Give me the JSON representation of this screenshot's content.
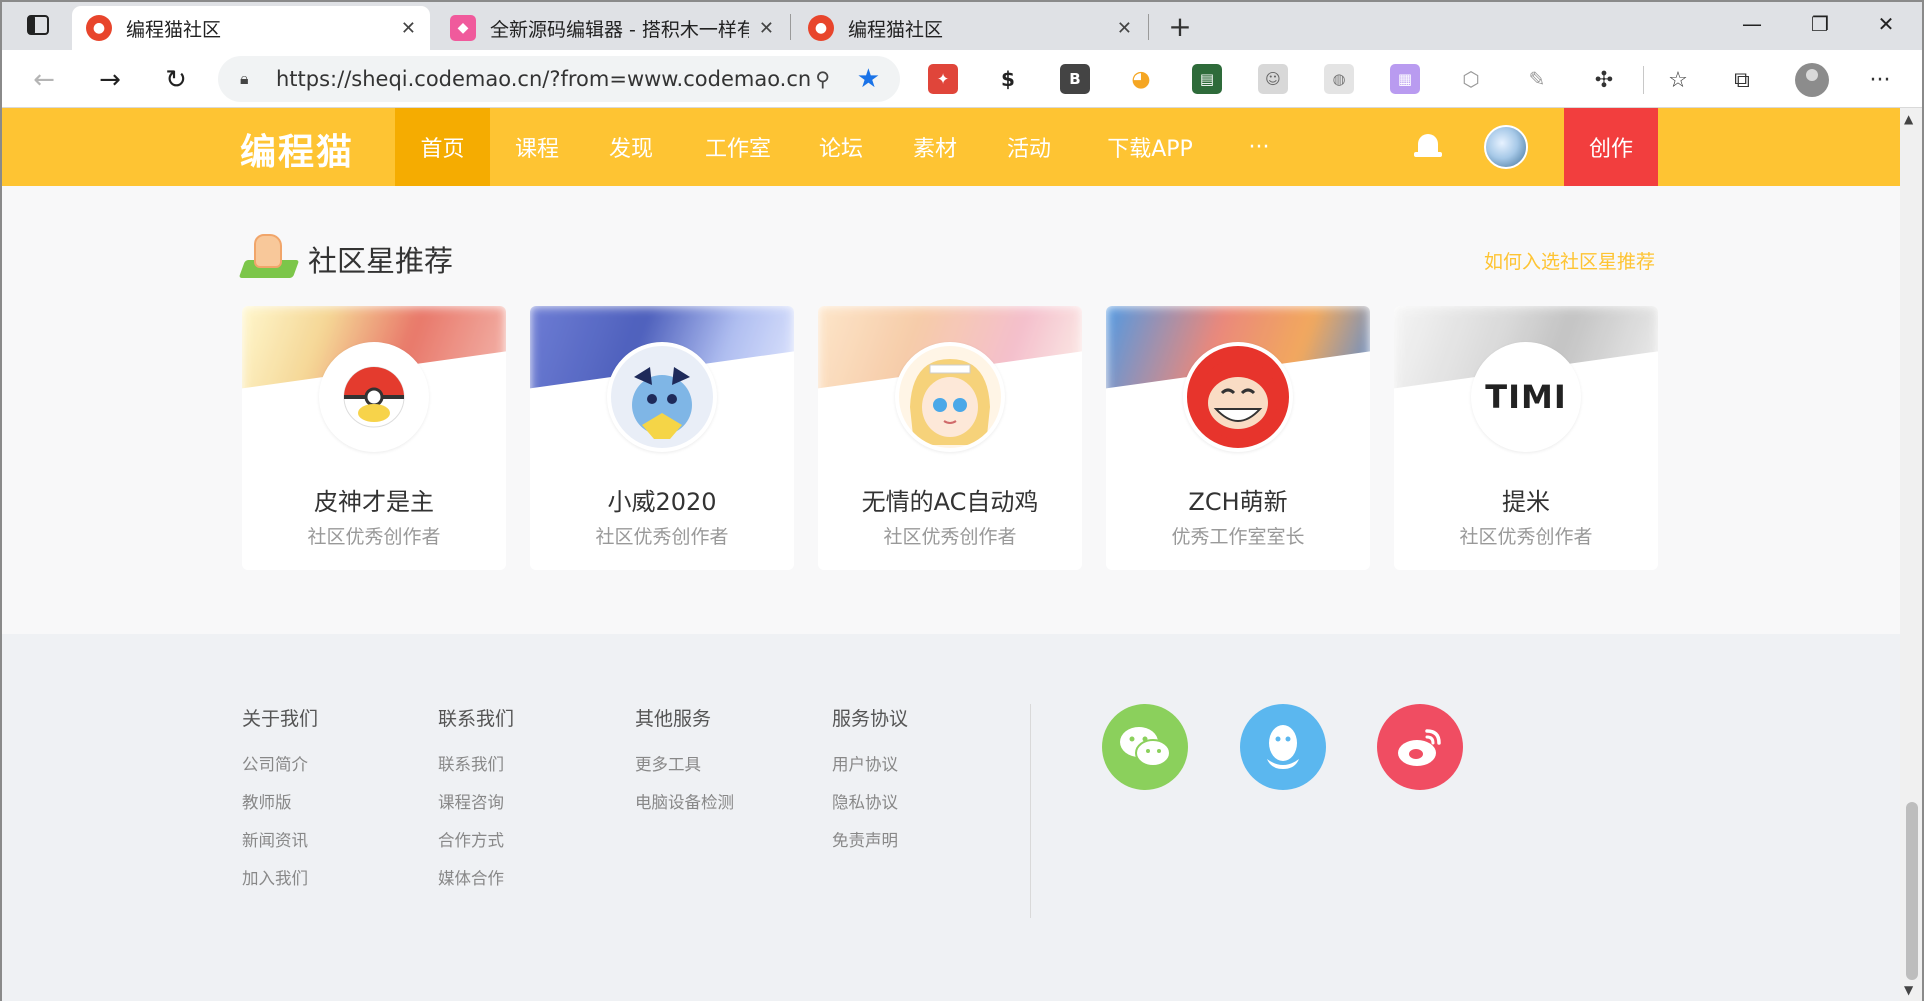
{
  "browser": {
    "tabs": [
      {
        "title": "编程猫社区",
        "active": true
      },
      {
        "title": "全新源码编辑器 - 搭积木一样有趣",
        "active": false
      },
      {
        "title": "编程猫社区",
        "active": false
      }
    ],
    "url": "https://sheqi.codemao.cn/?from=www.codemao.cn",
    "extensions": [
      "ext-1",
      "ext-s",
      "ext-b",
      "ext-palette",
      "ext-4",
      "ext-5",
      "ext-6",
      "ext-7",
      "ext-office",
      "ext-pen"
    ]
  },
  "nav": {
    "logo": "编程猫",
    "items": [
      "首页",
      "课程",
      "发现",
      "工作室",
      "论坛",
      "素材",
      "活动",
      "下载APP",
      "···"
    ],
    "create": "创作"
  },
  "recommend": {
    "title": "社区星推荐",
    "link": "如何入选社区星推荐",
    "cards": [
      {
        "name": "皮神才是主",
        "role": "社区优秀创作者",
        "avatar_text": ""
      },
      {
        "name": "小威2020",
        "role": "社区优秀创作者",
        "avatar_text": ""
      },
      {
        "name": "无情的AC自动鸡",
        "role": "社区优秀创作者",
        "avatar_text": ""
      },
      {
        "name": "ZCH萌新",
        "role": "优秀工作室室长",
        "avatar_text": ""
      },
      {
        "name": "提米",
        "role": "社区优秀创作者",
        "avatar_text": "TIMI"
      }
    ]
  },
  "footer": {
    "columns": [
      {
        "heading": "关于我们",
        "links": [
          "公司简介",
          "教师版",
          "新闻资讯",
          "加入我们"
        ]
      },
      {
        "heading": "联系我们",
        "links": [
          "联系我们",
          "课程咨询",
          "合作方式",
          "媒体合作"
        ]
      },
      {
        "heading": "其他服务",
        "links": [
          "更多工具",
          "电脑设备检测"
        ]
      },
      {
        "heading": "服务协议",
        "links": [
          "用户协议",
          "隐私协议",
          "免责声明"
        ]
      }
    ],
    "social": [
      "wechat",
      "qq",
      "weibo"
    ],
    "colors": {
      "wechat": "#8bd05c",
      "qq": "#5bb7ef",
      "weibo": "#f04d62"
    }
  },
  "colors": {
    "brand": "#fec433",
    "nav_active": "#f5ac01",
    "create": "#f23e3e"
  }
}
